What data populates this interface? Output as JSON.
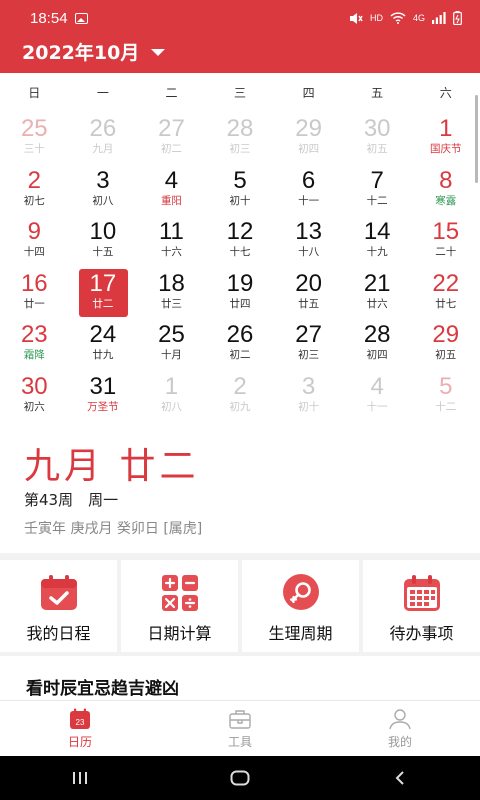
{
  "status": {
    "time": "18:54",
    "network": "HD",
    "signal_label": "4G"
  },
  "header": {
    "month_title": "2022年10月"
  },
  "weekdays": [
    "日",
    "一",
    "二",
    "三",
    "四",
    "五",
    "六"
  ],
  "calendar": {
    "rows": [
      [
        {
          "d": "25",
          "s": "三十",
          "dim": true,
          "wk": true
        },
        {
          "d": "26",
          "s": "九月",
          "dim": true
        },
        {
          "d": "27",
          "s": "初二",
          "dim": true
        },
        {
          "d": "28",
          "s": "初三",
          "dim": true
        },
        {
          "d": "29",
          "s": "初四",
          "dim": true
        },
        {
          "d": "30",
          "s": "初五",
          "dim": true
        },
        {
          "d": "1",
          "s": "国庆节",
          "wk": true,
          "sc": "red"
        }
      ],
      [
        {
          "d": "2",
          "s": "初七",
          "wk": true
        },
        {
          "d": "3",
          "s": "初八"
        },
        {
          "d": "4",
          "s": "重阳",
          "sc": "red"
        },
        {
          "d": "5",
          "s": "初十"
        },
        {
          "d": "6",
          "s": "十一"
        },
        {
          "d": "7",
          "s": "十二"
        },
        {
          "d": "8",
          "s": "寒露",
          "wk": true,
          "sc": "green"
        }
      ],
      [
        {
          "d": "9",
          "s": "十四",
          "wk": true
        },
        {
          "d": "10",
          "s": "十五"
        },
        {
          "d": "11",
          "s": "十六"
        },
        {
          "d": "12",
          "s": "十七"
        },
        {
          "d": "13",
          "s": "十八"
        },
        {
          "d": "14",
          "s": "十九"
        },
        {
          "d": "15",
          "s": "二十",
          "wk": true
        }
      ],
      [
        {
          "d": "16",
          "s": "廿一",
          "wk": true
        },
        {
          "d": "17",
          "s": "廿二",
          "sel": true
        },
        {
          "d": "18",
          "s": "廿三"
        },
        {
          "d": "19",
          "s": "廿四"
        },
        {
          "d": "20",
          "s": "廿五"
        },
        {
          "d": "21",
          "s": "廿六"
        },
        {
          "d": "22",
          "s": "廿七",
          "wk": true
        }
      ],
      [
        {
          "d": "23",
          "s": "霜降",
          "wk": true,
          "sc": "green"
        },
        {
          "d": "24",
          "s": "廿九"
        },
        {
          "d": "25",
          "s": "十月"
        },
        {
          "d": "26",
          "s": "初二"
        },
        {
          "d": "27",
          "s": "初三"
        },
        {
          "d": "28",
          "s": "初四"
        },
        {
          "d": "29",
          "s": "初五",
          "wk": true
        }
      ],
      [
        {
          "d": "30",
          "s": "初六",
          "wk": true
        },
        {
          "d": "31",
          "s": "万圣节",
          "sc": "red"
        },
        {
          "d": "1",
          "s": "初八",
          "dim": true
        },
        {
          "d": "2",
          "s": "初九",
          "dim": true
        },
        {
          "d": "3",
          "s": "初十",
          "dim": true
        },
        {
          "d": "4",
          "s": "十一",
          "dim": true
        },
        {
          "d": "5",
          "s": "十二",
          "dim": true,
          "wk": true
        }
      ]
    ]
  },
  "info": {
    "lunar_date": "九月 廿二",
    "week_line": "第43周　周一",
    "ganzhi": "壬寅年 庚戌月 癸卯日 [属虎]"
  },
  "tools": [
    {
      "label": "我的日程",
      "icon": "calendar-check-icon"
    },
    {
      "label": "日期计算",
      "icon": "calculator-icon"
    },
    {
      "label": "生理周期",
      "icon": "cycle-icon"
    },
    {
      "label": "待办事项",
      "icon": "calendar-grid-icon"
    }
  ],
  "section": {
    "title": "看时辰宜忌趋吉避凶"
  },
  "tabs": [
    {
      "label": "日历",
      "icon": "calendar-icon",
      "active": true,
      "badge": "23"
    },
    {
      "label": "工具",
      "icon": "toolbox-icon"
    },
    {
      "label": "我的",
      "icon": "person-icon"
    }
  ],
  "colors": {
    "accent": "#d9393f",
    "holiday_green": "#2f9a55"
  }
}
